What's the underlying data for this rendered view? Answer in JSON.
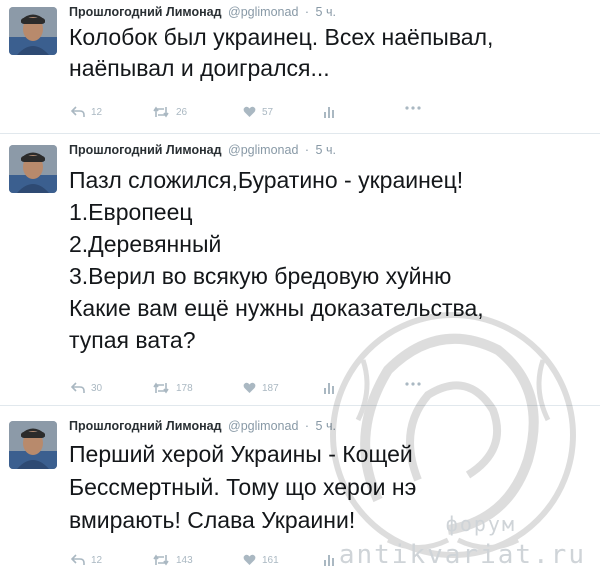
{
  "tweets": [
    {
      "name": "Прошлогодний Лимонад",
      "handle": "@pglimonad",
      "separator": "·",
      "time": "5 ч.",
      "lines": [
        "Колобок был украинец. Всех наёпывал,",
        "наёпывал и доигрался..."
      ],
      "replies": "12",
      "retweets": "26",
      "likes": "57"
    },
    {
      "name": "Прошлогодний Лимонад",
      "handle": "@pglimonad",
      "separator": "·",
      "time": "5 ч.",
      "lines": [
        "Пазл сложился,Буратино - украинец!",
        "1.Европеец",
        "2.Деревянный",
        "3.Верил во всякую бредовую хуйню",
        "Какие вам ещё нужны доказательства,",
        "тупая вата?"
      ],
      "replies": "30",
      "retweets": "178",
      "likes": "187"
    },
    {
      "name": "Прошлогодний Лимонад",
      "handle": "@pglimonad",
      "separator": "·",
      "time": "5 ч.",
      "lines": [
        "Перший херой Украины - Кощей",
        "Бессмертный. Тому що херои нэ",
        "вмирають! Слава Украини!"
      ],
      "replies": "12",
      "retweets": "143",
      "likes": "161"
    }
  ],
  "watermark": {
    "line1": "форум",
    "line2": "antikvariat.ru"
  },
  "colors": {
    "text": "#14171a",
    "secondary": "#8899a6",
    "action_icons": "#aab8c2",
    "divider": "#e1e8ed"
  }
}
